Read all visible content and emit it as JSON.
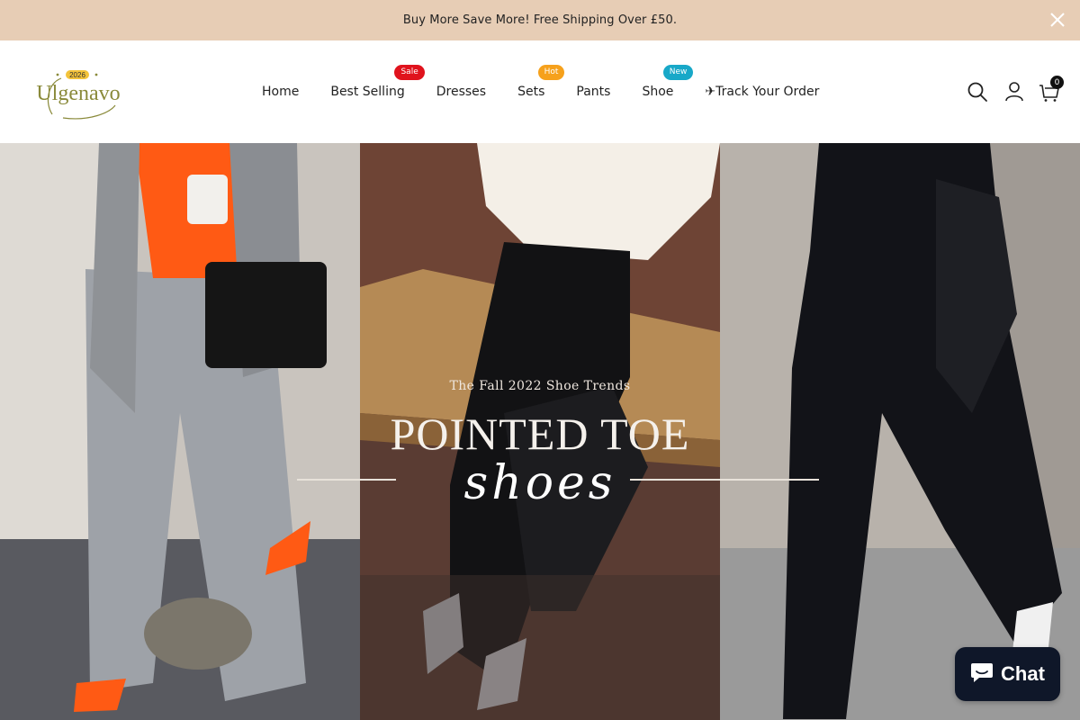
{
  "announcement": {
    "text": "Buy More Save More! Free Shipping Over £50.",
    "close_icon": "close-icon"
  },
  "brand": {
    "name": "Ulgenavo",
    "year": "2026",
    "color": "#8a8a3a"
  },
  "nav": {
    "items": [
      {
        "label": "Home"
      },
      {
        "label": "Best Selling",
        "badge": "Sale",
        "badge_color": "#e0131d"
      },
      {
        "label": "Dresses"
      },
      {
        "label": "Sets",
        "badge": "Hot",
        "badge_color": "#f6a11c"
      },
      {
        "label": "Pants"
      },
      {
        "label": "Shoe",
        "badge": "New",
        "badge_color": "#18a8c8"
      },
      {
        "label": "✈Track Your Order"
      }
    ]
  },
  "header_tools": {
    "search_icon": "search-icon",
    "account_icon": "user-icon",
    "cart_icon": "bag-icon",
    "cart_count": "0"
  },
  "hero": {
    "eyebrow": "The Fall 2022 Shoe Trends",
    "title": "POINTED TOE",
    "script": "shoes"
  },
  "chat": {
    "label": "Chat",
    "icon": "chat-bubble-icon",
    "color": "#0f1729"
  }
}
